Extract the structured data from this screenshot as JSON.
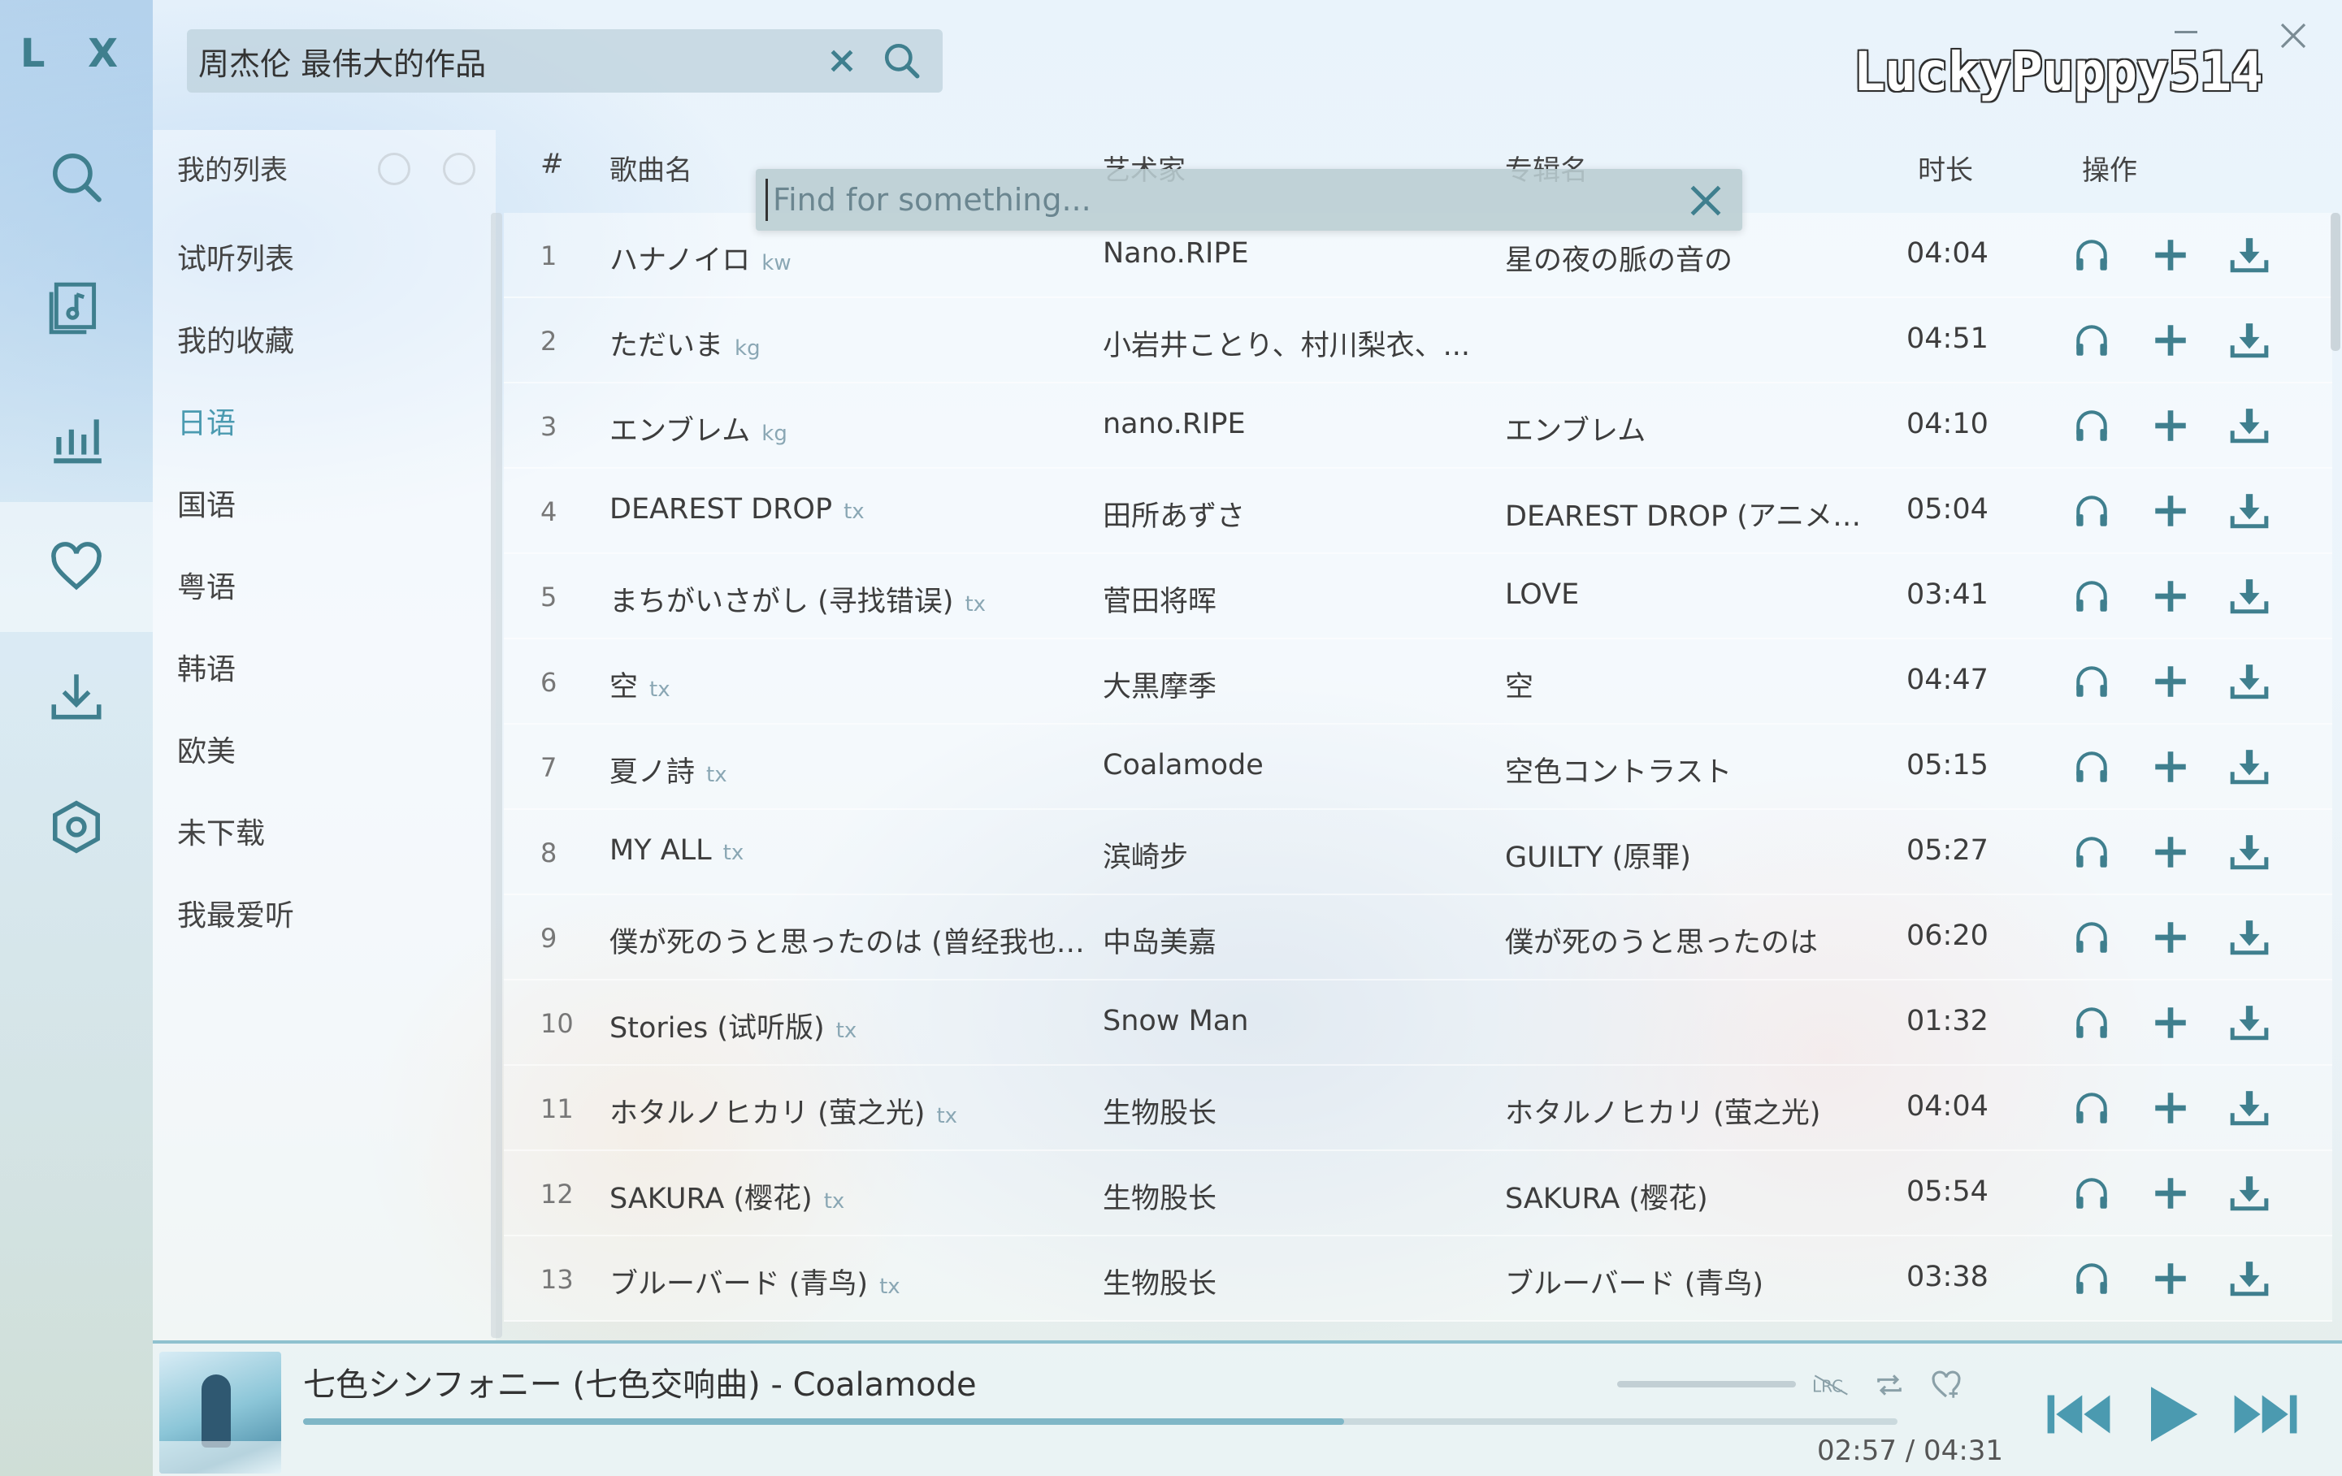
{
  "app": {
    "logo": "L X",
    "brand": "LuckyPuppy514"
  },
  "search": {
    "value": "周杰伦 最伟大的作品",
    "placeholder": ""
  },
  "nav": {
    "items": [
      "search-icon",
      "song-list-icon",
      "leaderboard-icon",
      "heart-icon",
      "download-icon",
      "settings-icon"
    ],
    "active": "heart-icon"
  },
  "mylist": {
    "header": "我的列表",
    "items": [
      "试听列表",
      "我的收藏",
      "日语",
      "国语",
      "粤语",
      "韩语",
      "欧美",
      "未下载",
      "我最爱听"
    ],
    "active_index": 2
  },
  "table": {
    "headers": {
      "num": "#",
      "name": "歌曲名",
      "artist": "艺术家",
      "album": "专辑名",
      "duration": "时长",
      "ops": "操作"
    },
    "rows": [
      {
        "num": "1",
        "name": "ハナノイロ",
        "src": "kw",
        "artist": "Nano.RIPE",
        "album": "星の夜の脈の音の",
        "duration": "04:04"
      },
      {
        "num": "2",
        "name": "ただいま",
        "src": "kg",
        "artist": "小岩井ことり、村川梨衣、...",
        "album": "",
        "duration": "04:51"
      },
      {
        "num": "3",
        "name": "エンブレム",
        "src": "kg",
        "artist": "nano.RIPE",
        "album": "エンブレム",
        "duration": "04:10"
      },
      {
        "num": "4",
        "name": "DEAREST DROP",
        "src": "tx",
        "artist": "田所あずさ",
        "album": "DEAREST DROP (アニメジ...",
        "duration": "05:04"
      },
      {
        "num": "5",
        "name": "まちがいさがし (寻找错误)",
        "src": "tx",
        "artist": "菅田将晖",
        "album": "LOVE",
        "duration": "03:41"
      },
      {
        "num": "6",
        "name": "空",
        "src": "tx",
        "artist": "大黒摩季",
        "album": "空",
        "duration": "04:47"
      },
      {
        "num": "7",
        "name": "夏ノ詩",
        "src": "tx",
        "artist": "Coalamode",
        "album": "空色コントラスト",
        "duration": "05:15"
      },
      {
        "num": "8",
        "name": "MY ALL",
        "src": "tx",
        "artist": "滨崎步",
        "album": "GUILTY (原罪)",
        "duration": "05:27"
      },
      {
        "num": "9",
        "name": "僕が死のうと思ったのは (曾经我也...",
        "src": "",
        "artist": "中岛美嘉",
        "album": "僕が死のうと思ったのは",
        "duration": "06:20"
      },
      {
        "num": "10",
        "name": "Stories (试听版)",
        "src": "tx",
        "artist": "Snow Man",
        "album": "",
        "duration": "01:32"
      },
      {
        "num": "11",
        "name": "ホタルノヒカリ (萤之光)",
        "src": "tx",
        "artist": "生物股长",
        "album": "ホタルノヒカリ (萤之光)",
        "duration": "04:04"
      },
      {
        "num": "12",
        "name": "SAKURA (樱花)",
        "src": "tx",
        "artist": "生物股长",
        "album": "SAKURA (樱花)",
        "duration": "05:54"
      },
      {
        "num": "13",
        "name": "ブルーバード (青鸟)",
        "src": "tx",
        "artist": "生物股长",
        "album": "ブルーバード (青鸟)",
        "duration": "03:38"
      }
    ],
    "row_icons": [
      "headphones-icon",
      "add-icon",
      "download-icon"
    ]
  },
  "find": {
    "placeholder": "Find for something..."
  },
  "player": {
    "title": "七色シンフォニー (七色交响曲) - Coalamode",
    "current": "02:57",
    "total": "04:31",
    "time_text": "02:57 / 04:31",
    "progress": 0.653,
    "lrc_label": "LRC",
    "accent": "#4b9ab0"
  },
  "colors": {
    "accent": "#4b9ab0",
    "icon": "#3f7f8e"
  }
}
